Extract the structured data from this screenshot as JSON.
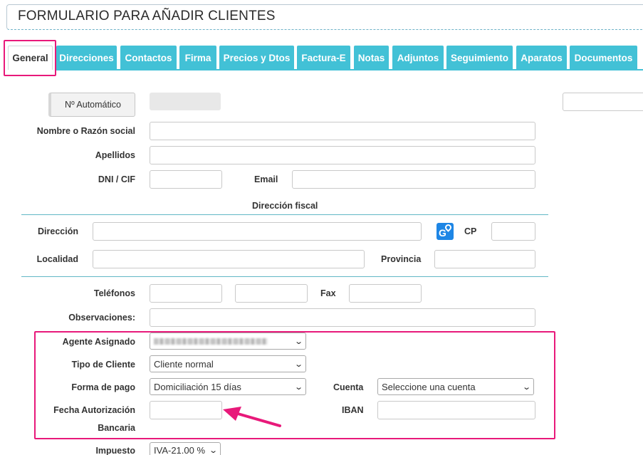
{
  "page": {
    "title": "FORMULARIO PARA AÑADIR CLIENTES"
  },
  "tabs": [
    {
      "label": "General"
    },
    {
      "label": "Direcciones"
    },
    {
      "label": "Contactos"
    },
    {
      "label": "Firma"
    },
    {
      "label": "Precios y Dtos"
    },
    {
      "label": "Factura-E"
    },
    {
      "label": "Notas"
    },
    {
      "label": "Adjuntos"
    },
    {
      "label": "Seguimiento"
    },
    {
      "label": "Aparatos"
    },
    {
      "label": "Documentos"
    }
  ],
  "form": {
    "auto_number_button": "Nº Automático",
    "name_label": "Nombre o Razón social",
    "surname_label": "Apellidos",
    "dni_label": "DNI / CIF",
    "email_label": "Email",
    "fiscal_section_title": "Dirección fiscal",
    "address_label": "Dirección",
    "cp_label": "CP",
    "city_label": "Localidad",
    "province_label": "Provincia",
    "phones_label": "Teléfonos",
    "fax_label": "Fax",
    "notes_label": "Observaciones:",
    "agent_label": "Agente Asignado",
    "client_type_label": "Tipo de Cliente",
    "client_type_value": "Cliente normal",
    "payment_label": "Forma de pago",
    "payment_value": "Domiciliación 15 días",
    "account_label": "Cuenta",
    "account_value": "Seleccione una cuenta",
    "bank_auth_label_line1": "Fecha Autorización",
    "bank_auth_label_line2": "Bancaria",
    "iban_label": "IBAN",
    "tax_label": "Impuesto",
    "tax_value": "IVA-21.00 %"
  },
  "icons": {
    "maps": "google-maps-icon"
  },
  "colors": {
    "tab_bg": "#42c1d6",
    "highlight": "#e8197a",
    "section_line": "#62b7c6",
    "maps_icon": "#1e86e5"
  }
}
